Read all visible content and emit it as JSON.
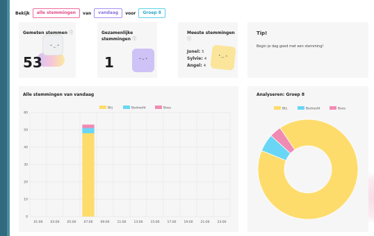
{
  "filter": {
    "prefix": "Bekijk",
    "moods": "alle stemmingen",
    "from_label": "van",
    "period": "vandaag",
    "for_label": "voor",
    "group": "Groep 8"
  },
  "cards": {
    "measured": {
      "title": "Gemeten stemmen",
      "info": "ⓘ",
      "value": "53"
    },
    "shared": {
      "title": "Gezamenlijke stemmingen",
      "info": "ⓘ",
      "value": "1"
    },
    "most": {
      "title": "Meeste stemmingen",
      "info": "ⓘ",
      "people": [
        {
          "name": "Jonel:",
          "count": "5"
        },
        {
          "name": "Sylvie:",
          "count": "4"
        },
        {
          "name": "Angel:",
          "count": "4"
        }
      ]
    },
    "tip": {
      "title": "Tip!",
      "text": "Begin je dag goed met een stemming!"
    }
  },
  "colors": {
    "blij": "#fddc6c",
    "bedroefd": "#6ad6f5",
    "boos": "#f08bb2",
    "pill_pink": "#f06a9c",
    "pill_purple": "#a68ef0",
    "pill_cyan": "#5ad0ea"
  },
  "icons": {
    "mascot_measured": "cube-mascot-icon",
    "mascot_shared": "cube-mascot-icon",
    "mascot_most": "cube-mascot-icon"
  },
  "chart_data": [
    {
      "type": "bar",
      "title": "Alle stemmingen van vandaag",
      "legend_position": "top",
      "categories": [
        "01:00",
        "03:00",
        "05:00",
        "07:00",
        "09:00",
        "11:00",
        "13:00",
        "15:00",
        "17:00",
        "19:00",
        "21:00",
        "23:00"
      ],
      "series": [
        {
          "name": "Blij",
          "values": [
            0,
            0,
            0,
            48,
            0,
            0,
            0,
            0,
            0,
            0,
            0,
            0
          ]
        },
        {
          "name": "Bedroefd",
          "values": [
            0,
            0,
            0,
            3,
            0,
            0,
            0,
            0,
            0,
            0,
            0,
            0
          ]
        },
        {
          "name": "Boos",
          "values": [
            0,
            0,
            0,
            2,
            0,
            0,
            0,
            0,
            0,
            0,
            0,
            0
          ]
        }
      ],
      "stacked": true,
      "ylim": [
        0,
        60
      ],
      "yticks": [
        0,
        10,
        20,
        30,
        40,
        50,
        60
      ],
      "grid": true
    },
    {
      "type": "pie",
      "title": "Analyseren: Groep 8",
      "donut": true,
      "legend_position": "top",
      "labels": [
        "Blij",
        "Bedroefd",
        "Boos"
      ],
      "values": [
        48,
        3,
        2
      ]
    }
  ]
}
